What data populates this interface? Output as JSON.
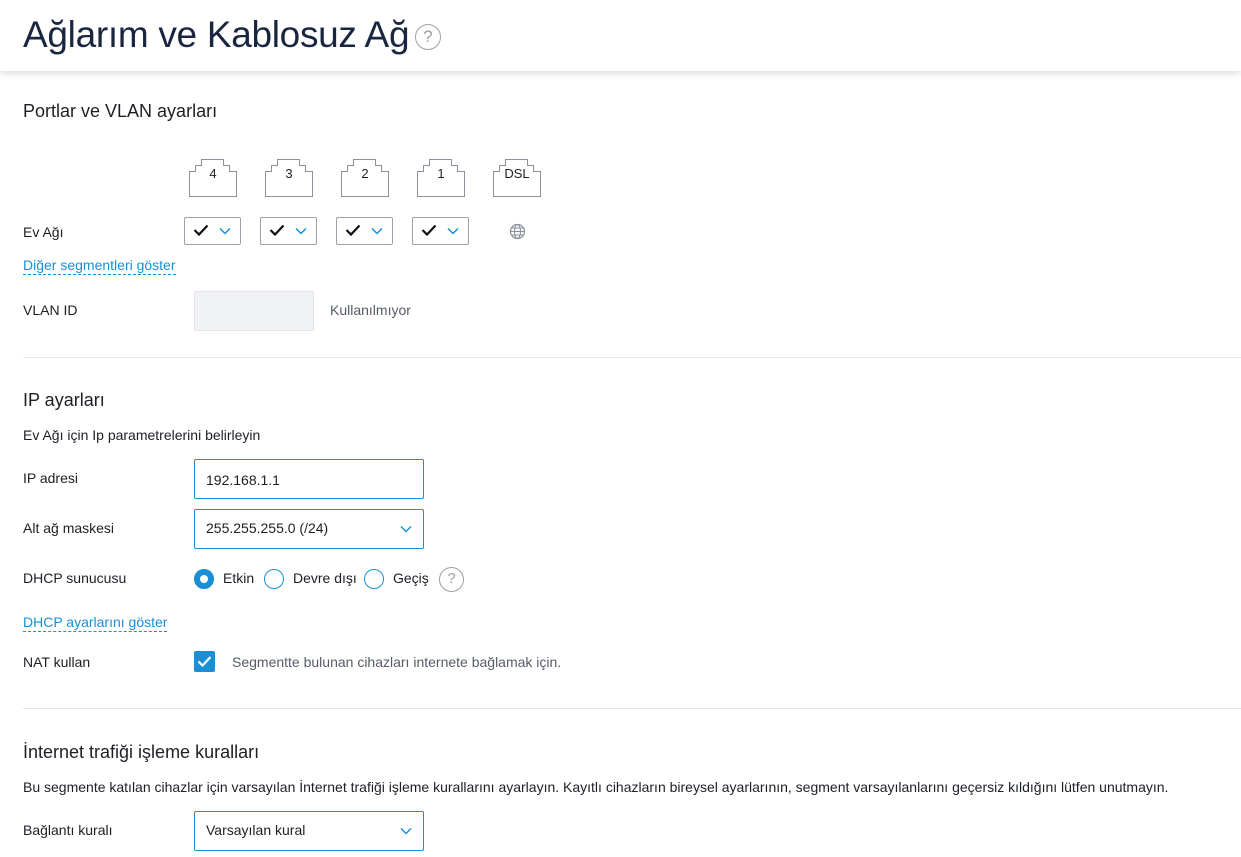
{
  "header": {
    "title": "Ağlarım ve Kablosuz Ağ",
    "help_glyph": "?"
  },
  "ports_section": {
    "title": "Portlar ve VLAN ayarları",
    "ports": [
      "4",
      "3",
      "2",
      "1",
      "DSL"
    ],
    "segment_label": "Ev Ağı",
    "port_states": [
      "checked",
      "checked",
      "checked",
      "checked"
    ],
    "dsl_icon": "globe-icon",
    "show_segments_link": "Diğer segmentleri göster",
    "vlan_label": "VLAN ID",
    "vlan_value": "",
    "vlan_status": "Kullanılmıyor"
  },
  "ip_section": {
    "title": "IP ayarları",
    "description": "Ev Ağı için Ip parametrelerini belirleyin",
    "ip_label": "IP adresi",
    "ip_value": "192.168.1.1",
    "mask_label": "Alt ağ maskesi",
    "mask_value": "255.255.255.0 (/24)",
    "dhcp_label": "DHCP sunucusu",
    "dhcp_options": [
      "Etkin",
      "Devre dışı",
      "Geçiş"
    ],
    "dhcp_selected": "Etkin",
    "dhcp_link": "DHCP ayarlarını göster",
    "nat_label": "NAT kullan",
    "nat_checked": true,
    "nat_description": "Segmentte bulunan cihazları internete bağlamak için."
  },
  "traffic_section": {
    "title": "İnternet trafiği işleme kuralları",
    "description": "Bu segmente katılan cihazlar için varsayılan İnternet trafiği işleme kurallarını ayarlayın. Kayıtlı cihazların bireysel ayarlarının, segment varsayılanlarını geçersiz kıldığını lütfen unutmayın.",
    "rule_label": "Bağlantı kuralı",
    "rule_value": "Varsayılan kural"
  },
  "colors": {
    "accent": "#1a8fd6",
    "title": "#1a2540",
    "divider": "#e4e6ea"
  }
}
